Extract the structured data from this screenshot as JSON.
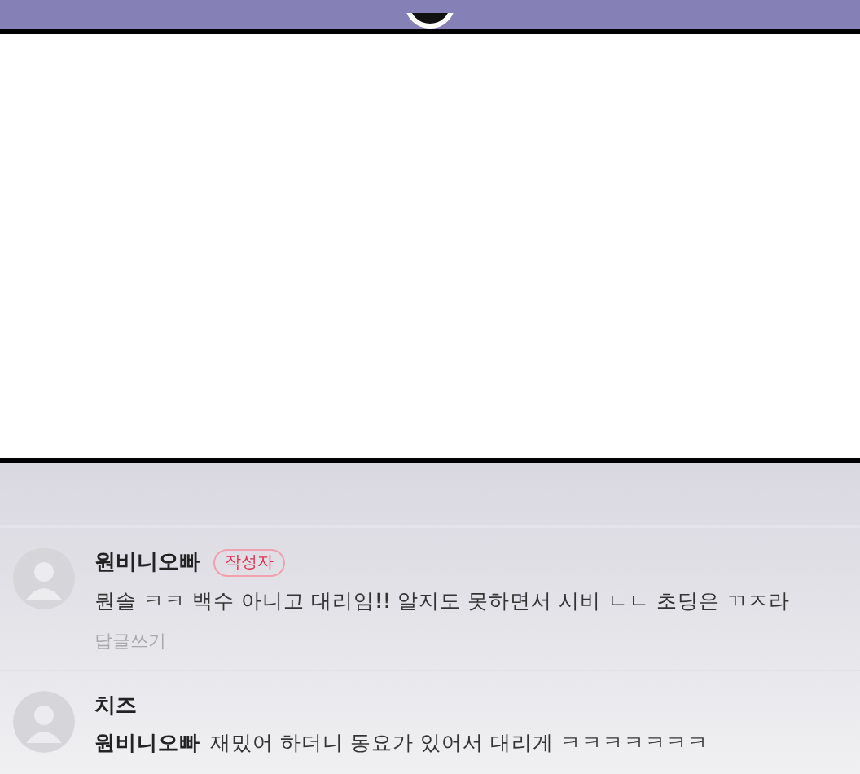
{
  "comments": [
    {
      "author": "원비니오빠",
      "badge": "작성자",
      "text": "뭔솔 ㅋㅋ 백수 아니고 대리임!! 알지도 못하면서 시비 ㄴㄴ 초딩은 ㄲㅈ라",
      "reply": "답글쓰기"
    },
    {
      "author": "치즈",
      "mention": "원비니오빠",
      "text": "재밌어 하더니 동요가 있어서 대리게 ㅋㅋㅋㅋㅋㅋㅋ"
    }
  ]
}
